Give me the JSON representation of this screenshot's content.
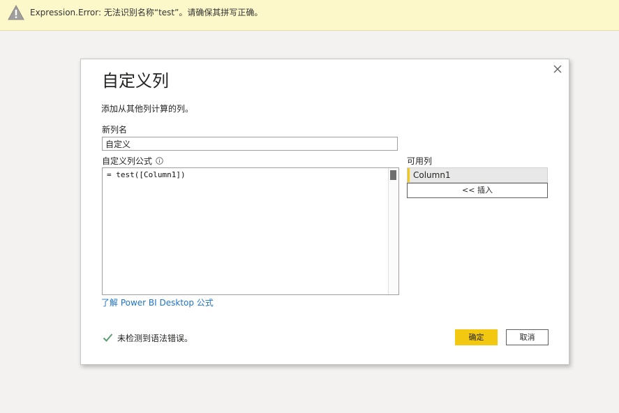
{
  "error_bar": {
    "icon": "warning-icon",
    "message": "Expression.Error: 无法识别名称“test”。请确保其拼写正确。",
    "color": "#fcf8c9"
  },
  "dialog": {
    "title": "自定义列",
    "subtitle": "添加从其他列计算的列。",
    "close_icon": "close-icon",
    "new_column_name": {
      "label": "新列名",
      "value": "自定义"
    },
    "formula": {
      "label": "自定义列公式",
      "info_icon": "info-icon",
      "value": "= test([Column1])"
    },
    "learn_link": "了解 Power BI Desktop 公式",
    "available_columns": {
      "label": "可用列",
      "items": [
        "Column1"
      ],
      "insert_button": "<< 插入"
    },
    "status": {
      "icon": "checkmark-icon",
      "text": "未检测到语法错误。",
      "color": "#5a9e6f"
    },
    "ok_button": "确定",
    "cancel_button": "取消",
    "accent_color": "#f2c811"
  }
}
